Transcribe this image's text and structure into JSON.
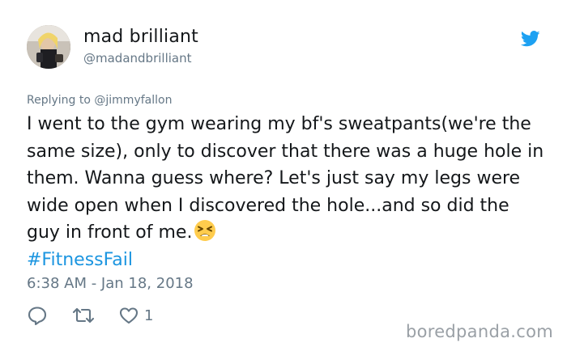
{
  "user": {
    "display_name": "mad brilliant",
    "handle": "@madandbrilliant"
  },
  "reply": {
    "prefix": "Replying to",
    "mention": "@jimmyfallon"
  },
  "tweet": {
    "text": "I went to the gym wearing my bf's sweatpants(we're the same size), only to discover that there was a huge hole in them. Wanna guess where? Let's just say my legs were wide open when I discovered the hole...and so did the guy in front of me.",
    "emoji": "tired-face-emoji",
    "hashtag": "#FitnessFail",
    "timestamp": "6:38 AM - Jan 18, 2018"
  },
  "actions": {
    "reply_icon": "speech-bubble-icon",
    "retweet_icon": "retweet-icon",
    "like_icon": "heart-icon",
    "like_count": "1"
  },
  "brand": {
    "icon": "twitter-bird-icon",
    "color": "#1da1f2",
    "hashtag_color": "#1b95e0",
    "muted_color": "#657786"
  },
  "watermark": "boredpanda.com"
}
